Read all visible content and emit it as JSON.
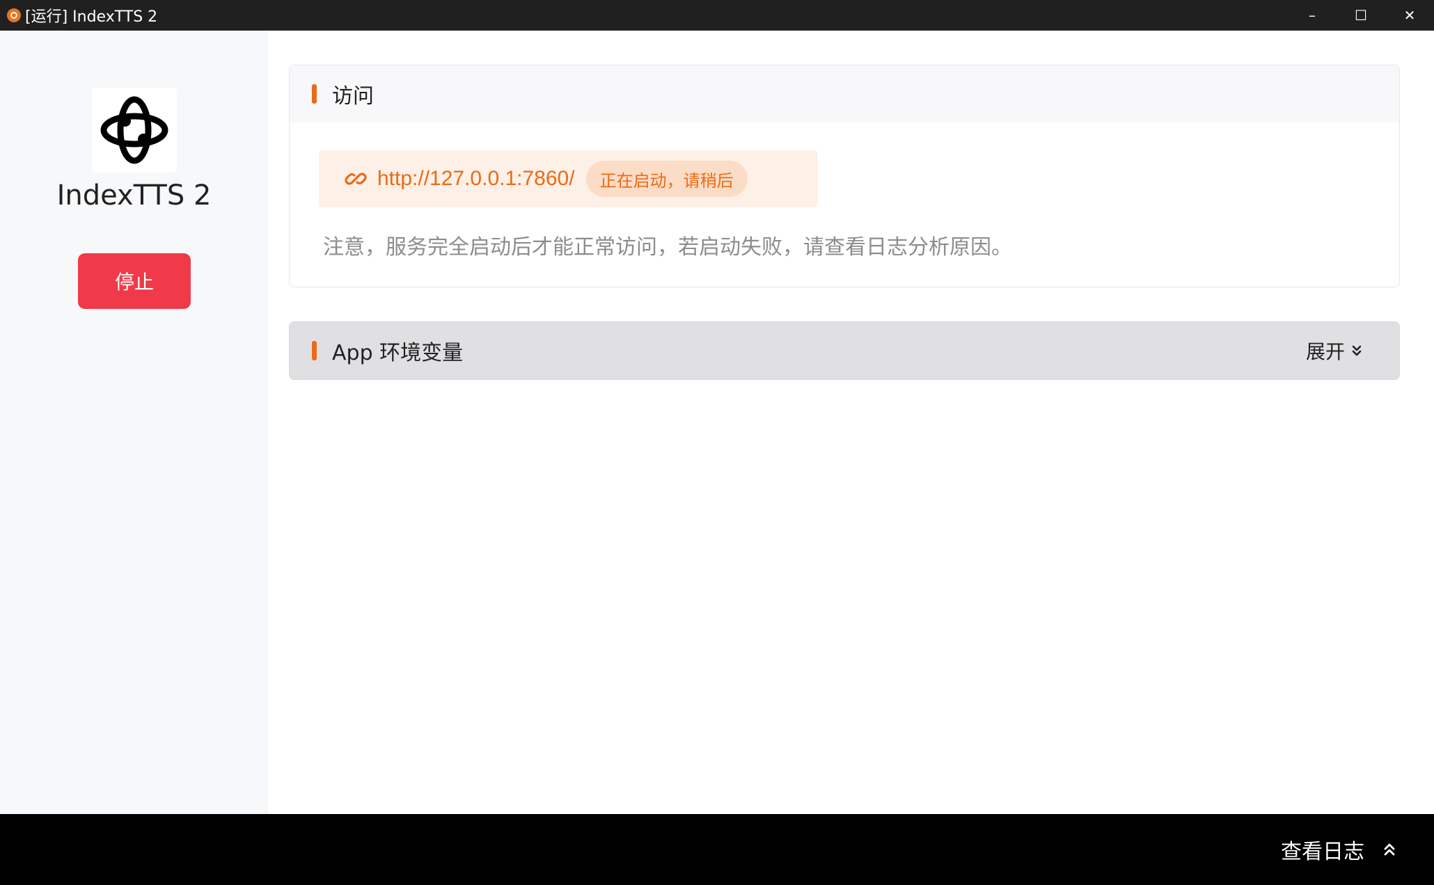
{
  "window": {
    "title": "[运行] IndexTTS 2",
    "controls": {
      "minimize": "–",
      "maximize": "☐",
      "close": "✕"
    }
  },
  "sidebar": {
    "app_name": "IndexTTS 2",
    "logo_icon": "indextts-logo-icon",
    "stop_label": "停止"
  },
  "access_card": {
    "title": "访问",
    "url": "http://127.0.0.1:7860/",
    "status": "正在启动，请稍后",
    "notice": "注意，服务完全启动后才能正常访问，若启动失败，请查看日志分析原因。"
  },
  "env_card": {
    "title": "App 环境变量",
    "expand_label": "展开"
  },
  "bottom": {
    "log_label": "查看日志"
  },
  "colors": {
    "accent": "#ec6a16",
    "stop": "#f03a4a",
    "titlebar": "#202020",
    "bottombar": "#000000"
  }
}
